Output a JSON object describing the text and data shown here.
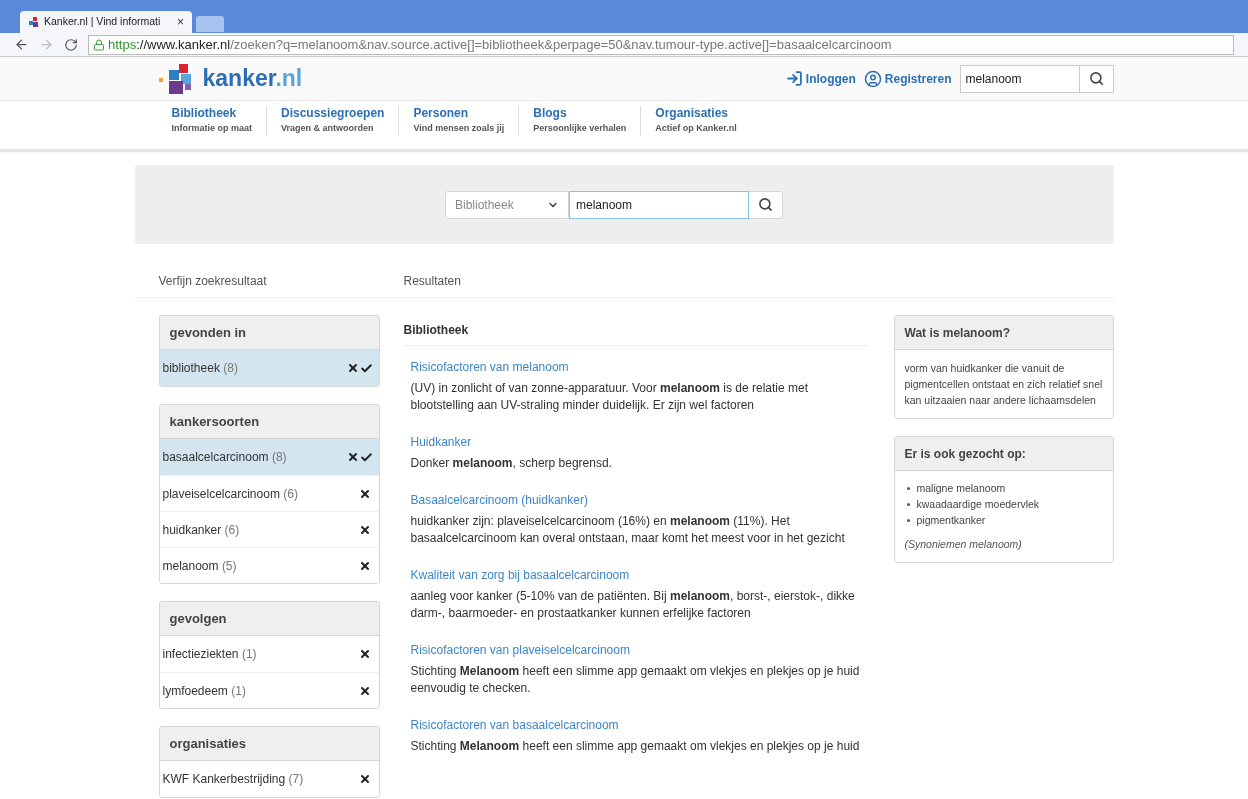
{
  "browser": {
    "tab": {
      "title": "Kanker.nl | Vind informati",
      "close": "×"
    },
    "url": {
      "scheme": "https",
      "host": "://www.kanker.nl",
      "path": "/zoeken?q=melanoom&nav.source.active[]=bibliotheek&perpage=50&nav.tumour-type.active[]=basaalcelcarcinoom"
    }
  },
  "header": {
    "logo": {
      "name": "kanker",
      "suffix": ".nl"
    },
    "login": "Inloggen",
    "register": "Registreren",
    "search": {
      "value": "melanoom"
    }
  },
  "nav": [
    {
      "title": "Bibliotheek",
      "subtitle": "Informatie op maat"
    },
    {
      "title": "Discussiegroepen",
      "subtitle": "Vragen & antwoorden"
    },
    {
      "title": "Personen",
      "subtitle": "Vind mensen zoals jij"
    },
    {
      "title": "Blogs",
      "subtitle": "Persoonlijke verhalen"
    },
    {
      "title": "Organisaties",
      "subtitle": "Actief op Kanker.nl"
    }
  ],
  "search_panel": {
    "scope": "Bibliotheek",
    "value": "melanoom"
  },
  "refine_heading": "Verfijn zoekresultaat",
  "results_heading": "Resultaten",
  "facets": [
    {
      "title": "gevonden in",
      "items": [
        {
          "name": "bibliotheek",
          "count": "(8)",
          "selected": true
        }
      ]
    },
    {
      "title": "kankersoorten",
      "items": [
        {
          "name": "basaalcelcarcinoom",
          "count": "(8)",
          "selected": true
        },
        {
          "name": "plaveiselcelcarcinoom",
          "count": "(6)",
          "selected": false
        },
        {
          "name": "huidkanker",
          "count": "(6)",
          "selected": false
        },
        {
          "name": "melanoom",
          "count": "(5)",
          "selected": false
        }
      ]
    },
    {
      "title": "gevolgen",
      "items": [
        {
          "name": "infectieziekten",
          "count": "(1)",
          "selected": false
        },
        {
          "name": "lymfoedeem",
          "count": "(1)",
          "selected": false
        }
      ]
    },
    {
      "title": "organisaties",
      "items": [
        {
          "name": "KWF Kankerbestrijding",
          "count": "(7)",
          "selected": false
        }
      ]
    }
  ],
  "results": {
    "section": "Bibliotheek",
    "items": [
      {
        "title": "Risicofactoren van melanoom",
        "snippet": "(UV) in zonlicht of van zonne-apparatuur. Voor **melanoom** is de relatie met blootstelling aan UV-straling minder duidelijk. Er zijn wel factoren"
      },
      {
        "title": "Huidkanker",
        "snippet": "Donker **melanoom**, scherp begrensd."
      },
      {
        "title": "Basaalcelcarcinoom (huidkanker)",
        "snippet": "huidkanker zijn: plaveiselcelcarcinoom (16%) en **melanoom** (11%). Het basaalcelcarcinoom kan overal ontstaan, maar komt het meest voor in het gezicht"
      },
      {
        "title": "Kwaliteit van zorg bij basaalcelcarcinoom",
        "snippet": "aanleg voor kanker (5-10% van de patiënten. Bij **melanoom**, borst-, eierstok-, dikke darm-, baarmoeder- en prostaatkanker kunnen erfelijke factoren"
      },
      {
        "title": "Risicofactoren van plaveiselcelcarcinoom",
        "snippet": "Stichting **Melanoom** heeft een slimme app gemaakt om vlekjes en plekjes op je huid eenvoudig te checken."
      },
      {
        "title": "Risicofactoren van basaalcelcarcinoom",
        "snippet": "Stichting **Melanoom** heeft een slimme app gemaakt om vlekjes en plekjes op je huid"
      }
    ]
  },
  "definition": {
    "title": "Wat is melanoom?",
    "text": "vorm van huidkanker die vanuit de pigmentcellen ontstaat en zich relatief snel kan uitzaaien naar andere lichaamsdelen"
  },
  "related": {
    "title": "Er is ook gezocht op:",
    "items": [
      "maligne melanoom",
      "kwaadaardige moedervlek",
      "pigmentkanker"
    ],
    "note": "(Synoniemen melanoom)"
  }
}
